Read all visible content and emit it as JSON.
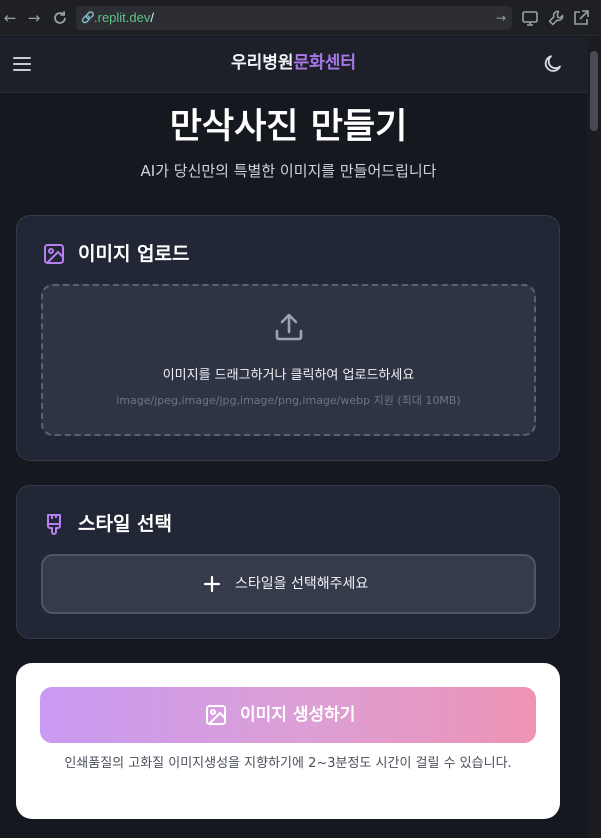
{
  "browser": {
    "url_host": ".replit.dev",
    "url_path": "/"
  },
  "header": {
    "brand_part1": "우리병원",
    "brand_part2": "문화센터"
  },
  "page": {
    "title": "만삭사진 만들기",
    "subtitle": "AI가 당신만의 특별한 이미지를 만들어드립니다"
  },
  "upload": {
    "heading": "이미지 업로드",
    "dropzone_text": "이미지를 드래그하거나 클릭하여 업로드하세요",
    "dropzone_hint": "image/jpeg,image/jpg,image/png,image/webp 지원 (최대 10MB)"
  },
  "style": {
    "heading": "스타일 선택",
    "select_label": "스타일을 선택해주세요"
  },
  "generate": {
    "button_label": "이미지 생성하기",
    "note": "인쇄품질의 고화질 이미지생성을 지향하기에 2~3분정도 시간이 걸릴 수 있습니다."
  },
  "colors": {
    "accent": "#a978e8",
    "gradient_start": "#c99af2",
    "gradient_end": "#ee93b4",
    "background": "#16181f",
    "card": "#222735"
  },
  "icons": {
    "back": "arrow-left-icon",
    "forward": "arrow-right-icon",
    "reload": "reload-icon",
    "site_info": "link-icon",
    "url_go": "arrow-right-icon",
    "screen": "monitor-icon",
    "tools": "wrench-icon",
    "open_external": "external-link-icon",
    "menu": "hamburger-menu-icon",
    "theme": "moon-icon",
    "upload_heading": "image-icon",
    "upload": "upload-icon",
    "style_heading": "paintbrush-icon",
    "add": "plus-icon",
    "generate": "image-icon"
  }
}
